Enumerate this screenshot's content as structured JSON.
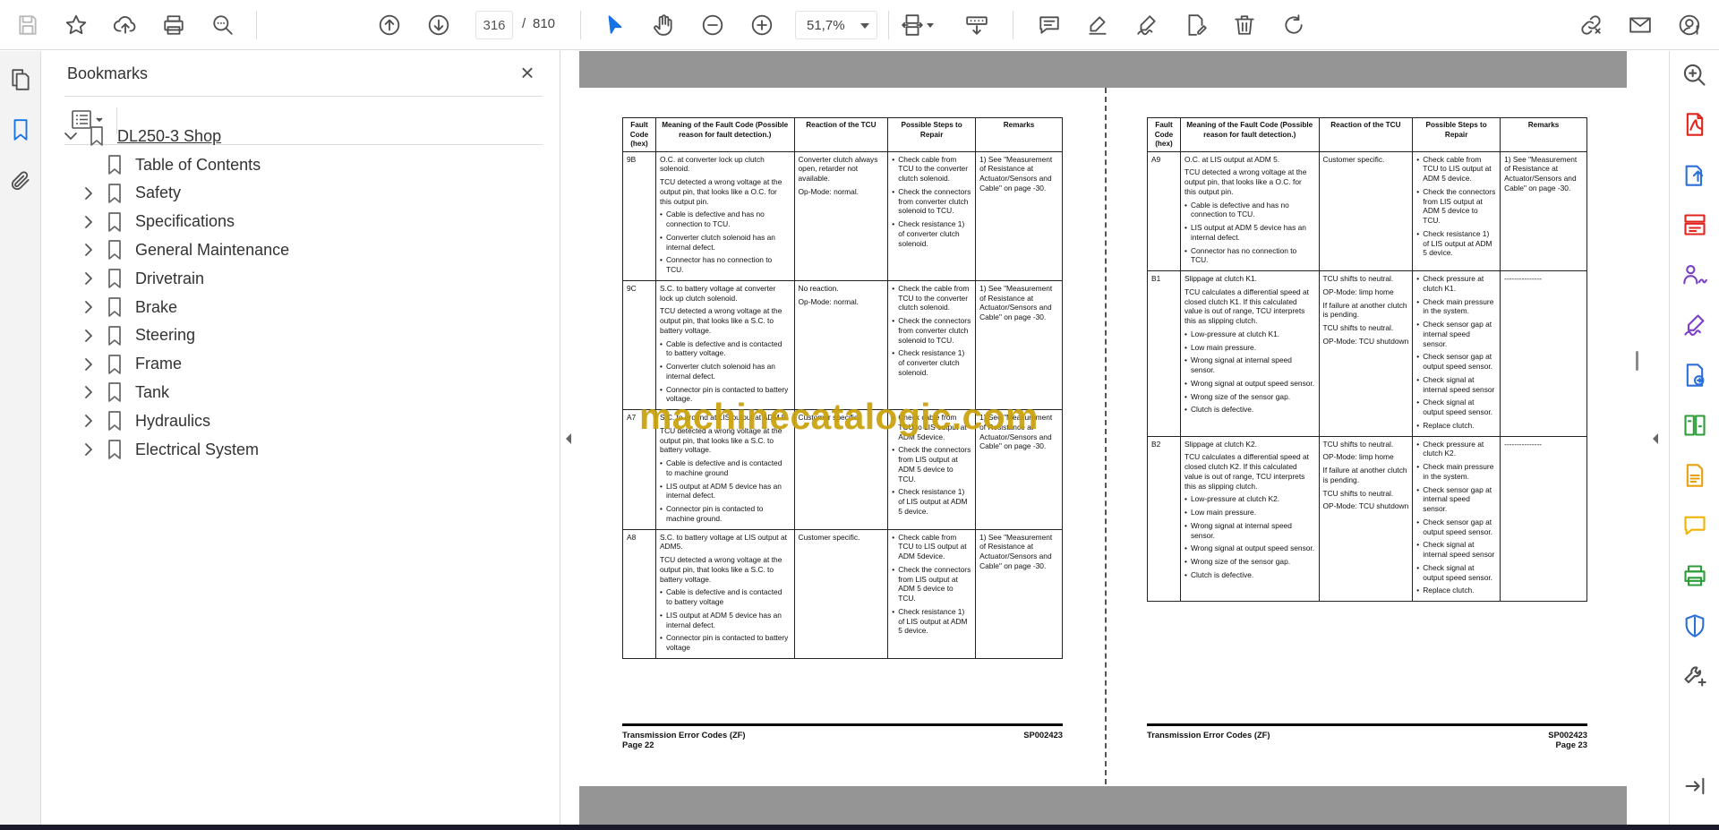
{
  "toolbar": {
    "icons": [
      "save-icon",
      "star-icon",
      "upload-icon",
      "print-icon",
      "find-icon",
      "previous-page-icon",
      "next-page-icon",
      "select-tool-icon",
      "hand-tool-icon",
      "zoom-out-icon",
      "zoom-in-icon",
      "page-fit-icon",
      "scroll-mode-icon",
      "comment-icon",
      "highlight-icon",
      "sign-icon",
      "fill-sign-icon",
      "delete-icon",
      "rotate-icon",
      "share-link-icon",
      "email-icon",
      "account-icon"
    ],
    "current_page": "316",
    "page_separator": "/",
    "total_pages": "810",
    "zoom": "51,7%"
  },
  "left_rail": {
    "icons": [
      "pages-thumbnail-icon",
      "bookmark-icon",
      "attachment-icon"
    ],
    "active": "bookmark-icon"
  },
  "bookmarks": {
    "title": "Bookmarks",
    "root": "DL250-3 Shop",
    "items": [
      {
        "label": "Table of Contents",
        "expandable": false
      },
      {
        "label": "Safety",
        "expandable": true
      },
      {
        "label": "Specifications",
        "expandable": true
      },
      {
        "label": "General Maintenance",
        "expandable": true
      },
      {
        "label": "Drivetrain",
        "expandable": true
      },
      {
        "label": "Brake",
        "expandable": true
      },
      {
        "label": "Steering",
        "expandable": true
      },
      {
        "label": "Frame",
        "expandable": true
      },
      {
        "label": "Tank",
        "expandable": true
      },
      {
        "label": "Hydraulics",
        "expandable": true
      },
      {
        "label": "Electrical System",
        "expandable": true
      }
    ]
  },
  "document": {
    "headers": [
      "Fault Code (hex)",
      "Meaning of the Fault Code (Possible reason for fault detection.)",
      "Reaction of the TCU",
      "Possible Steps to Repair",
      "Remarks"
    ],
    "left_page": {
      "rows": [
        {
          "code": "9B",
          "meaning": [
            "O.C. at converter lock up clutch solenoid.",
            "TCU detected a wrong voltage at the output pin, that looks like a O.C. for this output pin."
          ],
          "meaning_bullets": [
            "Cable is defective and has no connection to TCU.",
            "Converter clutch solenoid has an internal defect.",
            "Connector has no connection to TCU."
          ],
          "reaction": [
            "Converter clutch always open, retarder not available.",
            "Op-Mode: normal."
          ],
          "steps": [
            "Check cable from TCU to the converter clutch solenoid.",
            "Check the connectors from converter clutch solenoid to TCU.",
            "Check resistance 1) of converter clutch solenoid."
          ],
          "remarks": "1) See \"Measurement of Resistance at Actuator/Sensors and Cable\" on page -30."
        },
        {
          "code": "9C",
          "meaning": [
            "S.C. to battery voltage at converter lock up clutch solenoid.",
            "TCU detected a wrong voltage at the output pin, that looks like a S.C. to battery voltage."
          ],
          "meaning_bullets": [
            "Cable is defective and is contacted to battery voltage.",
            "Converter clutch solenoid has an internal defect.",
            "Connector pin is contacted to battery voltage."
          ],
          "reaction": [
            "No reaction.",
            "Op-Mode: normal."
          ],
          "steps": [
            "Check the cable from TCU to the converter clutch solenoid.",
            "Check the connectors from converter clutch solenoid to TCU.",
            "Check resistance 1) of converter clutch solenoid."
          ],
          "remarks": "1) See \"Measurement of Resistance at Actuator/Sensors and Cable\" on page -30."
        },
        {
          "code": "A7",
          "meaning": [
            "S.C. to ground at LIS output at ADM 5.",
            "TCU detected a wrong voltage at the output pin, that looks like a S.C. to battery voltage."
          ],
          "meaning_bullets": [
            "Cable is defective and is contacted to machine ground",
            "LIS output at ADM 5 device has an internal defect.",
            "Connector pin is contacted to machine ground."
          ],
          "reaction": [
            "Customer specific."
          ],
          "steps": [
            "Check cable from TCU to LIS output at ADM 5device.",
            "Check the connectors from LIS output at ADM 5 device to TCU.",
            "Check resistance 1) of LIS output at ADM 5 device."
          ],
          "remarks": "1) See \"Measurement of Resistance at Actuator/Sensors and Cable\" on page -30."
        },
        {
          "code": "A8",
          "meaning": [
            "S.C. to battery voltage at LIS output at ADM5.",
            "TCU detected a wrong voltage at the output pin, that looks like a S.C. to battery voltage."
          ],
          "meaning_bullets": [
            "Cable is defective and is contacted to battery voltage",
            "LIS output at ADM 5 device has an internal defect.",
            "Connector pin is contacted to battery voltage"
          ],
          "reaction": [
            "Customer specific."
          ],
          "steps": [
            "Check cable from TCU to LIS output at ADM 5device.",
            "Check the connectors from LIS output at ADM 5 device to TCU.",
            "Check resistance 1) of LIS output at ADM 5 device."
          ],
          "remarks": "1) See \"Measurement of Resistance at Actuator/Sensors and Cable\" on page -30."
        }
      ],
      "footer_title": "Transmission Error Codes (ZF)",
      "footer_code": "SP002423",
      "footer_page": "Page 22"
    },
    "right_page": {
      "rows": [
        {
          "code": "A9",
          "meaning": [
            "O.C. at LIS output at ADM 5.",
            "TCU detected a wrong voltage at the output pin, that looks like a O.C. for this output pin."
          ],
          "meaning_bullets": [
            "Cable is defective and has no connection to TCU.",
            "LIS output at ADM 5 device has an internal defect.",
            "Connector has no connection to TCU."
          ],
          "reaction": [
            "Customer specific."
          ],
          "steps": [
            "Check cable from TCU to LIS output at ADM 5 device.",
            "Check the connectors from LIS output at ADM 5 device to TCU.",
            "Check resistance 1) of LIS output at ADM 5 device."
          ],
          "remarks": "1) See \"Measurement of Resistance at Actuator/Sensors and Cable\" on page -30."
        },
        {
          "code": "B1",
          "meaning": [
            "Slippage at clutch K1.",
            "TCU calculates a differential speed at closed clutch K1. If this calculated value is out of range, TCU interprets this as slipping clutch."
          ],
          "meaning_bullets": [
            "Low-pressure at clutch K1.",
            "Low main pressure.",
            "Wrong signal at internal speed sensor.",
            "Wrong signal at output speed sensor.",
            "Wrong size of the sensor gap.",
            "Clutch is defective."
          ],
          "reaction": [
            "TCU shifts to neutral.",
            "OP-Mode: limp home",
            "If failure at another clutch is pending.",
            "TCU shifts to neutral.",
            "OP-Mode: TCU shutdown"
          ],
          "steps": [
            "Check pressure at clutch K1.",
            "Check main pressure in the system.",
            "Check sensor gap at internal speed sensor.",
            "Check sensor gap at output speed sensor.",
            "Check signal at internal speed sensor",
            "Check signal at output speed sensor.",
            "Replace clutch."
          ],
          "remarks": "---------------"
        },
        {
          "code": "B2",
          "meaning": [
            "Slippage at clutch K2.",
            "TCU calculates a differential speed at closed clutch K2. If this calculated value is out of range, TCU interprets this as slipping clutch."
          ],
          "meaning_bullets": [
            "Low-pressure at clutch K2.",
            "Low main pressure.",
            "Wrong signal at internal speed sensor.",
            "Wrong signal at output speed sensor.",
            "Wrong size of the sensor gap.",
            "Clutch is defective."
          ],
          "reaction": [
            "TCU shifts to neutral.",
            "OP-Mode: limp home",
            "If failure at another clutch is pending.",
            "TCU shifts to neutral.",
            "OP-Mode: TCU shutdown"
          ],
          "steps": [
            "Check pressure at clutch K2.",
            "Check main pressure in the system.",
            "Check sensor gap at internal speed sensor.",
            "Check sensor gap at output speed sensor.",
            "Check signal at internal speed sensor",
            "Check signal at output speed sensor.",
            "Replace clutch."
          ],
          "remarks": "---------------"
        }
      ],
      "footer_title": "Transmission Error Codes (ZF)",
      "footer_code": "SP002423",
      "footer_page": "Page 23"
    },
    "watermark": "machinecatalogic.com"
  },
  "right_rail": {
    "icons": [
      "zoom-search-icon",
      "export-pdf-icon",
      "create-pdf-icon",
      "organize-pages-icon",
      "request-signature-icon",
      "fill-sign-icon",
      "send-for-review-icon",
      "compare-files-icon",
      "edit-pdf-icon",
      "comment-icon",
      "print-production-icon",
      "protect-icon",
      "more-tools-icon",
      "expand-panel-icon"
    ],
    "colors": {
      "red": "#e1251b",
      "blue": "#2d6fd9",
      "purple": "#7b3fc8",
      "green": "#2d9d3a",
      "orange": "#e8a00f",
      "gold": "#f0b400",
      "gray": "#505050"
    }
  }
}
